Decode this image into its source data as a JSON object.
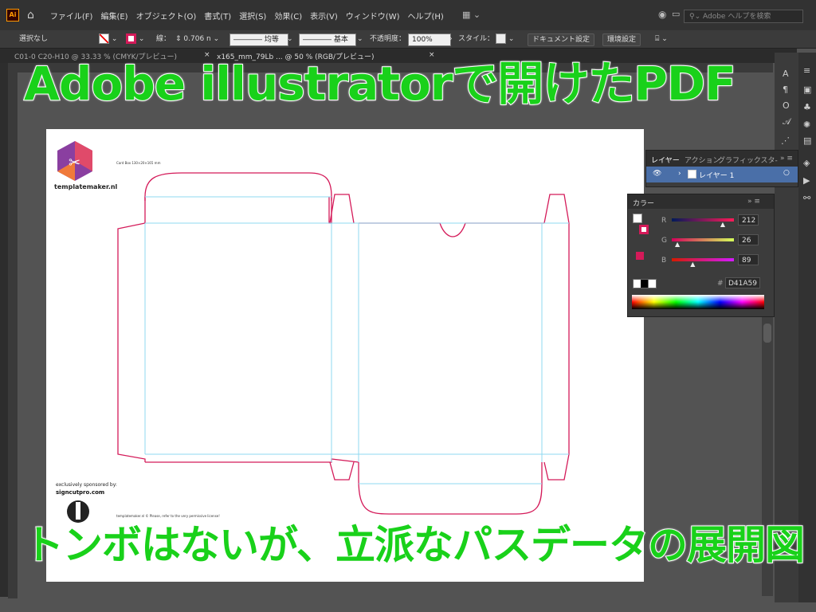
{
  "menubar": {
    "app_logo": "Ai",
    "items": [
      "ファイル(F)",
      "編集(E)",
      "オブジェクト(O)",
      "書式(T)",
      "選択(S)",
      "効果(C)",
      "表示(V)",
      "ウィンドウ(W)",
      "ヘルプ(H)"
    ],
    "help_placeholder": "Adobe ヘルプを検索"
  },
  "control_bar": {
    "selection": "選択なし",
    "stroke_label": "線：",
    "stroke_value": "0.706 n",
    "profile_label": "均等",
    "brush_label": "基本",
    "opacity_label": "不透明度：",
    "opacity_value": "100%",
    "style_label": "スタイル：",
    "doc_settings": "ドキュメント設定",
    "prefs": "環境設定",
    "fill_color": "#ffffff",
    "stroke_color": "#d41a59"
  },
  "tabs": [
    {
      "label": "C01-0 C20-H10 @ 33.33 % (CMYK/プレビュー)"
    },
    {
      "label": "x165_mm_79Lb ... @ 50 % (RGB/プレビュー)"
    }
  ],
  "artboard": {
    "logo_text": "templatemaker.nl",
    "small_title": "Card Box 130×20×165 mm",
    "sponsor_line1": "exclusively sponsored by:",
    "sponsor_line2": "signcutpro.com",
    "license": "templatemaker.nl © Please, refer to the very permissive license!"
  },
  "layers_panel": {
    "tabs": [
      "レイヤー",
      "アクション",
      "グラフィックスタ-"
    ],
    "layer_name": "レイヤー 1"
  },
  "color_panel": {
    "title": "カラー",
    "channels": [
      {
        "name": "R",
        "value": "212",
        "fraction": 0.831
      },
      {
        "name": "G",
        "value": "26",
        "fraction": 0.102
      },
      {
        "name": "B",
        "value": "89",
        "fraction": 0.349
      }
    ],
    "hex_label": "#",
    "hex": "D41A59",
    "color": "#d41a59"
  },
  "overlay": {
    "title": "Adobe illustratorで開けたPDF",
    "subtitle": "トンボはないが、立派なパスデータの展開図",
    "color": "#19d11a"
  }
}
